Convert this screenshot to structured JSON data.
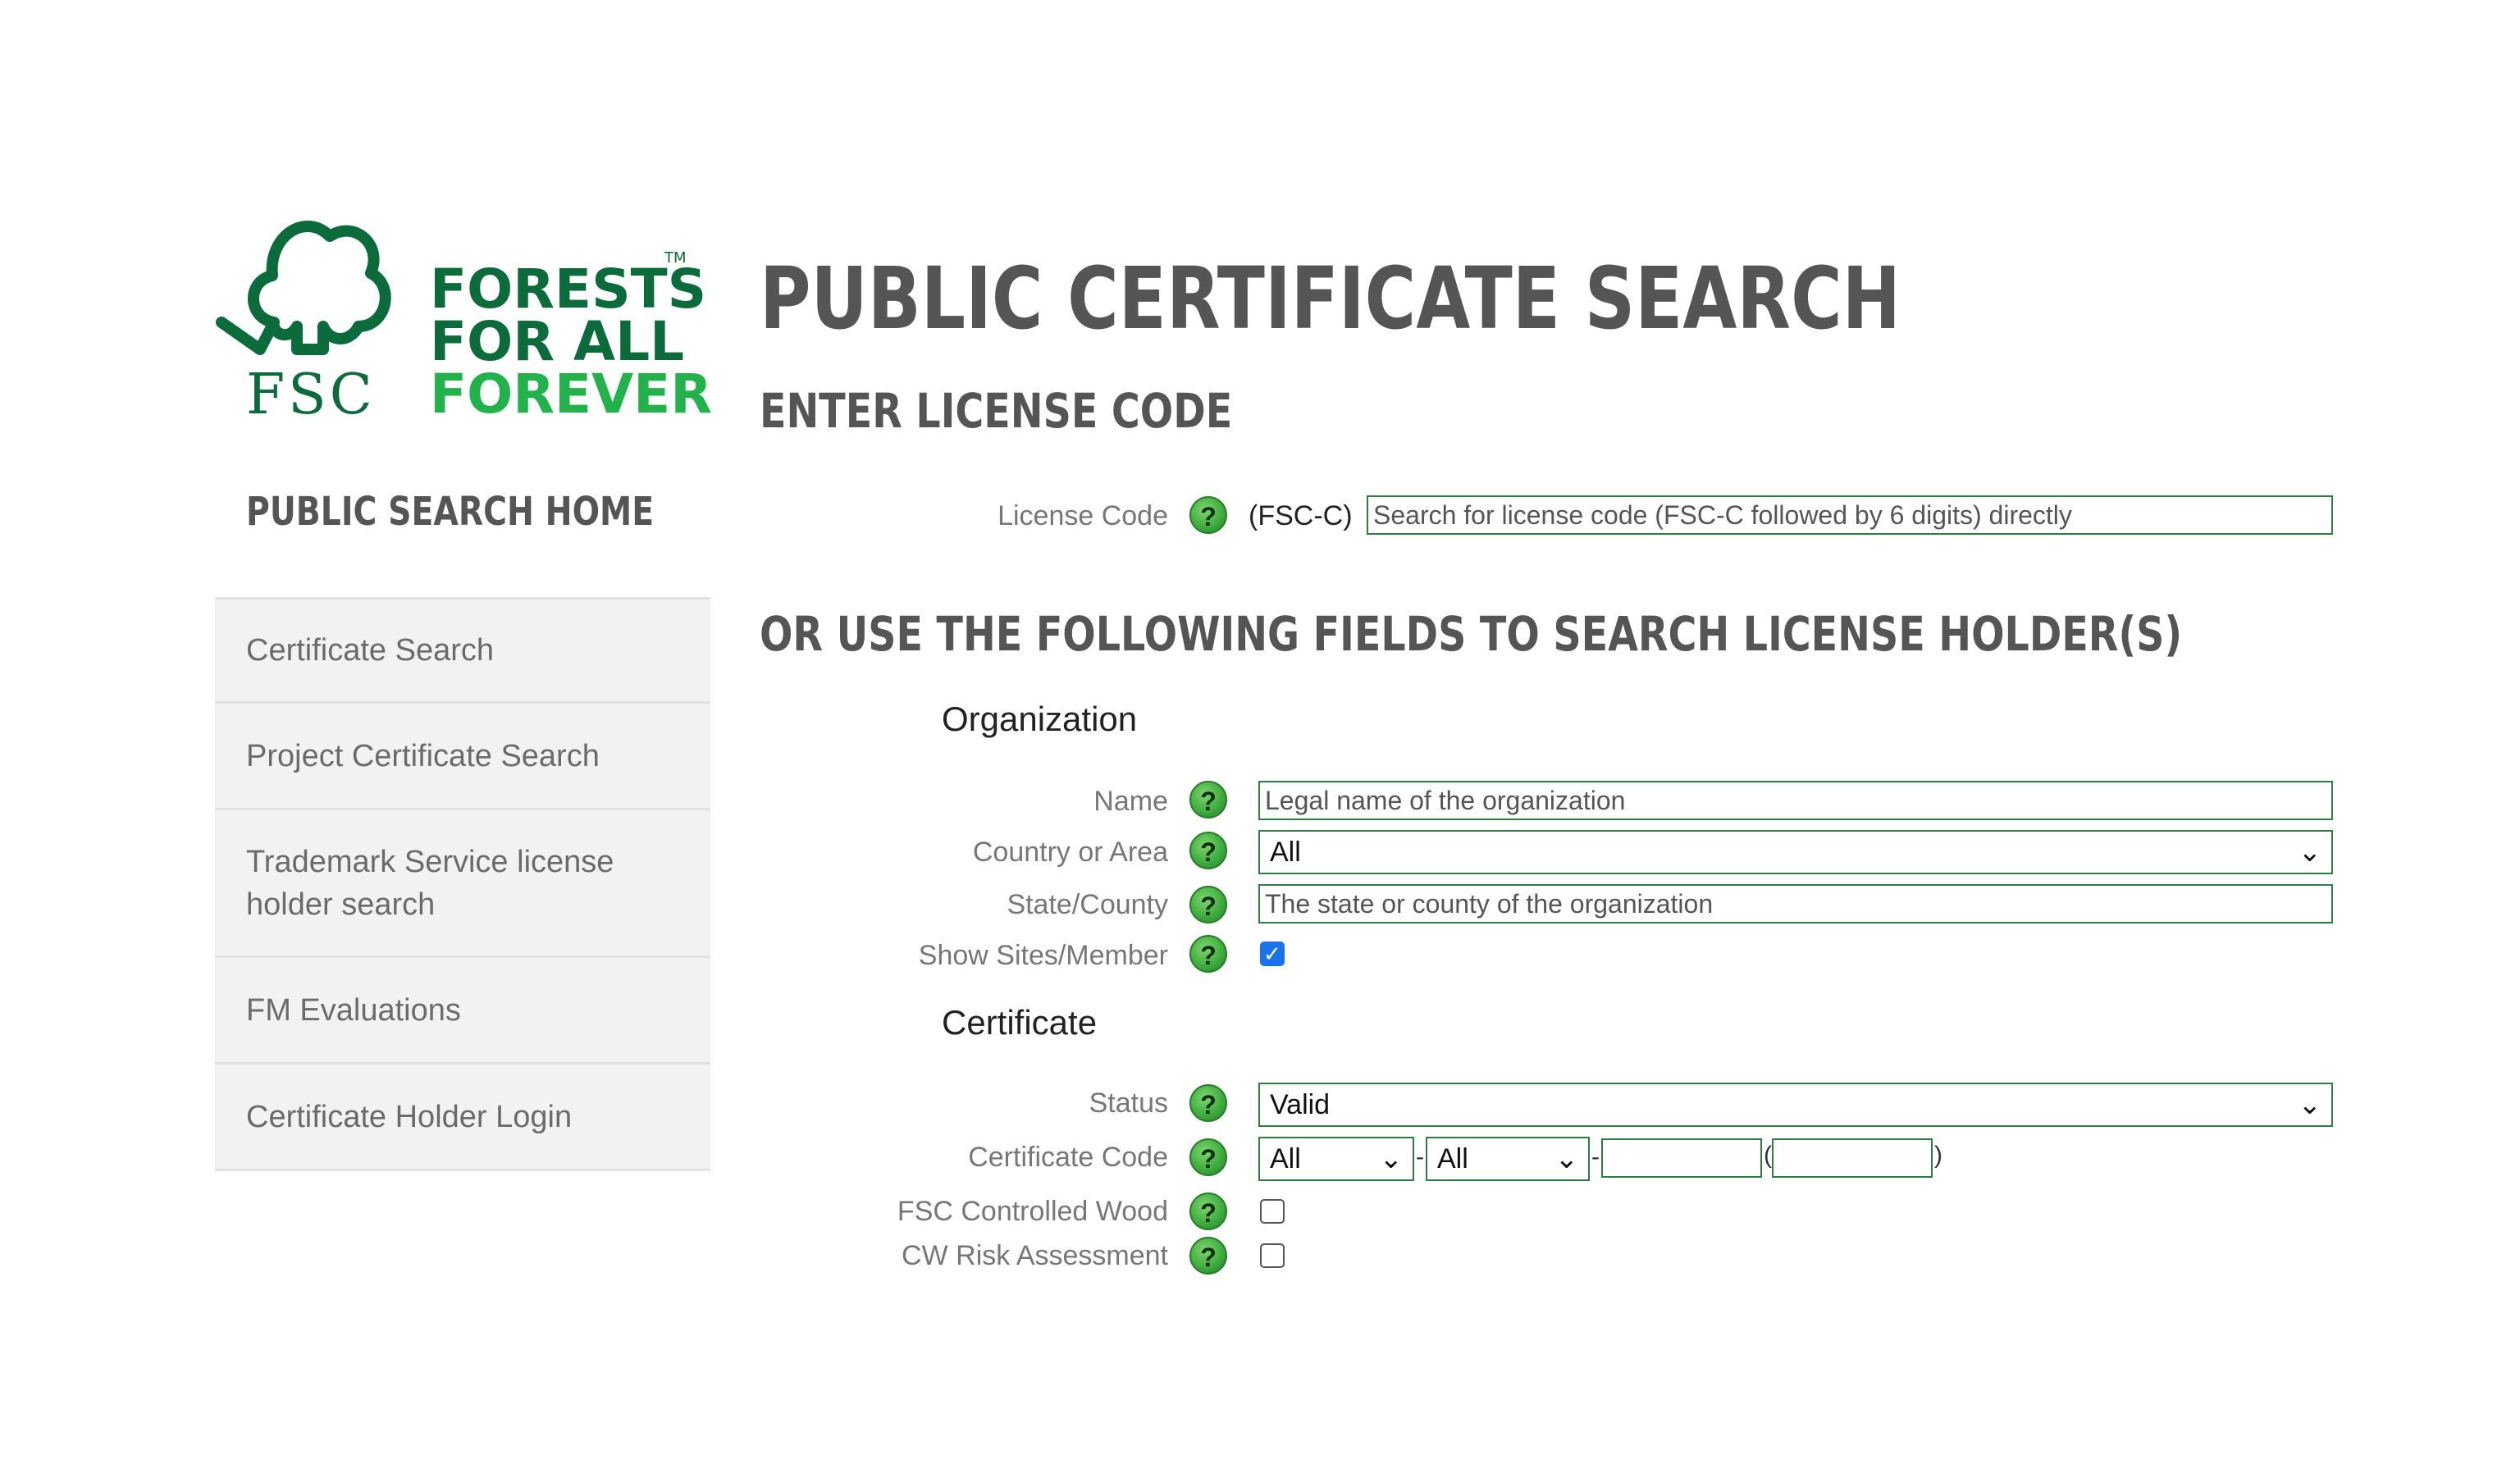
{
  "logo": {
    "line1": "FORESTS",
    "line2": "FOR ALL",
    "line3": "FOREVER",
    "brand": "FSC",
    "tm": "TM",
    "colors": {
      "dark_green": "#0b6b3a",
      "bright_green": "#21b24b"
    }
  },
  "header": {
    "title": "PUBLIC CERTIFICATE SEARCH",
    "license_heading": "ENTER LICENSE CODE",
    "or_heading": "OR USE THE FOLLOWING FIELDS TO SEARCH LICENSE HOLDER(S)"
  },
  "sidebar": {
    "home": "PUBLIC SEARCH HOME",
    "items": [
      {
        "label": "Certificate Search"
      },
      {
        "label": "Project Certificate Search"
      },
      {
        "label": "Trademark Service license holder search"
      },
      {
        "label": "FM Evaluations"
      },
      {
        "label": "Certificate Holder Login"
      }
    ]
  },
  "license": {
    "label": "License Code",
    "prefix": "(FSC-C)",
    "placeholder": "Search for license code (FSC-C followed by 6 digits) directly"
  },
  "organization": {
    "section": "Organization",
    "name_label": "Name",
    "name_placeholder": "Legal name of the organization",
    "country_label": "Country or Area",
    "country_value": "All",
    "state_label": "State/County",
    "state_placeholder": "The state or county of the organization",
    "sites_label": "Show Sites/Member",
    "sites_checked": true
  },
  "certificate": {
    "section": "Certificate",
    "status_label": "Status",
    "status_value": "Valid",
    "code_label": "Certificate Code",
    "code_select1": "All",
    "code_select2": "All",
    "code_sep_dash": "-",
    "code_open_paren": "(",
    "code_close_paren": ")",
    "cw_label": "FSC Controlled Wood",
    "cw_checked": false,
    "risk_label": "CW Risk Assessment",
    "risk_checked": false
  },
  "help_glyph": "?",
  "check_glyph": "✓",
  "chevron_glyph": "⌄"
}
